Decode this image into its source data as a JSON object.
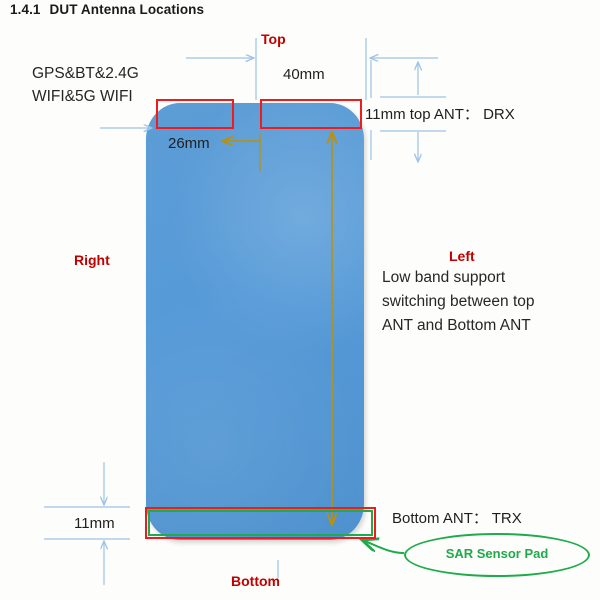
{
  "page": {
    "title_number": "1.4.1",
    "title_text": "DUT Antenna Locations",
    "background_color": "#fdfefb"
  },
  "colors": {
    "phone_blue": "#5B9BD5",
    "annotation_red": "#EE1C1C",
    "label_red": "#C00000",
    "sar_green": "#1FAA4B",
    "dimension_blue": "#9DC3E6",
    "arrow_gold": "#BF9000",
    "text_dark": "#262626"
  },
  "orientation_labels": {
    "top": "Top",
    "bottom": "Bottom",
    "left": "Left",
    "right": "Right"
  },
  "antennas": {
    "top_left_label_line1": "GPS&BT&2.4G",
    "top_left_label_line2": "WIFI&5G WIFI",
    "top_right_label": "11mm top ANT： DRX",
    "bottom_label": "Bottom ANT： TRX",
    "sar_pad_label": "SAR Sensor Pad"
  },
  "dimensions": {
    "top_right_width": "40mm",
    "top_left_width": "26mm",
    "top_band_height": "11mm",
    "bottom_band_height": "11mm"
  },
  "left_description": {
    "line1": "Low band support",
    "line2": "switching between top",
    "line3": "ANT and Bottom ANT"
  }
}
